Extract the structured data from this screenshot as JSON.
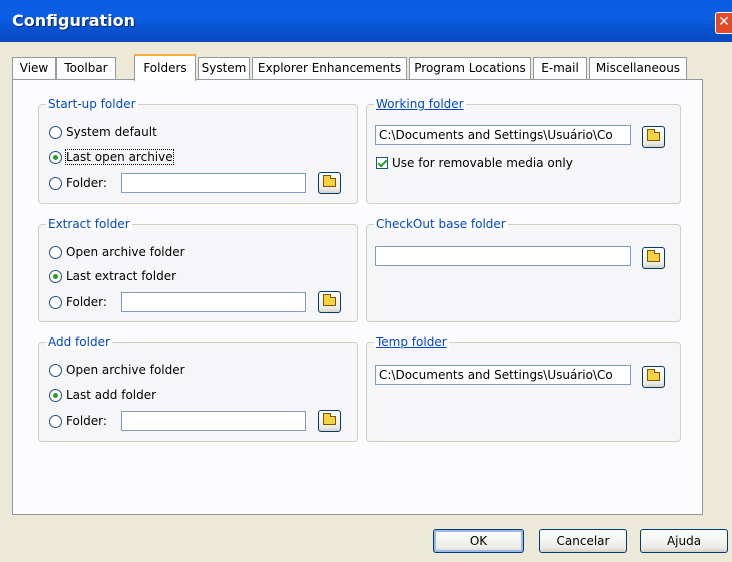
{
  "window": {
    "title": "Configuration",
    "close_glyph": "✕"
  },
  "tabs": [
    {
      "label": "View"
    },
    {
      "label": "Toolbar"
    },
    {
      "label": "Folders"
    },
    {
      "label": "System"
    },
    {
      "label": "Explorer Enhancements"
    },
    {
      "label": "Program Locations"
    },
    {
      "label": "E-mail"
    },
    {
      "label": "Miscellaneous"
    }
  ],
  "active_tab": "Folders",
  "startup_folder": {
    "title": "Start-up folder",
    "options": [
      {
        "label": "System default",
        "checked": false
      },
      {
        "label": "Last open archive",
        "checked": true
      },
      {
        "label": "Folder:",
        "checked": false
      }
    ],
    "folder_value": ""
  },
  "extract_folder": {
    "title": "Extract folder",
    "options": [
      {
        "label": "Open archive folder",
        "checked": false
      },
      {
        "label": "Last extract folder",
        "checked": true
      },
      {
        "label": "Folder:",
        "checked": false
      }
    ],
    "folder_value": ""
  },
  "add_folder": {
    "title": "Add folder",
    "options": [
      {
        "label": "Open archive folder",
        "checked": false
      },
      {
        "label": "Last add folder",
        "checked": true
      },
      {
        "label": "Folder:",
        "checked": false
      }
    ],
    "folder_value": ""
  },
  "working_folder": {
    "title": "Working folder",
    "path": "C:\\Documents and Settings\\Usuário\\Co",
    "removable_label": "Use for removable media only",
    "removable_checked": true
  },
  "checkout_folder": {
    "title": "CheckOut base folder",
    "path": ""
  },
  "temp_folder": {
    "title": "Temp folder",
    "path": "C:\\Documents and Settings\\Usuário\\Co"
  },
  "buttons": {
    "ok": "OK",
    "cancel": "Cancelar",
    "help": "Ajuda"
  },
  "icons": {
    "browse": "folder-icon",
    "close": "close-icon"
  },
  "colors": {
    "titlebar": "#0A5CE0",
    "group_label": "#0046D5",
    "active_tab_accent": "#F8B034",
    "radio_dot": "#21A121"
  }
}
